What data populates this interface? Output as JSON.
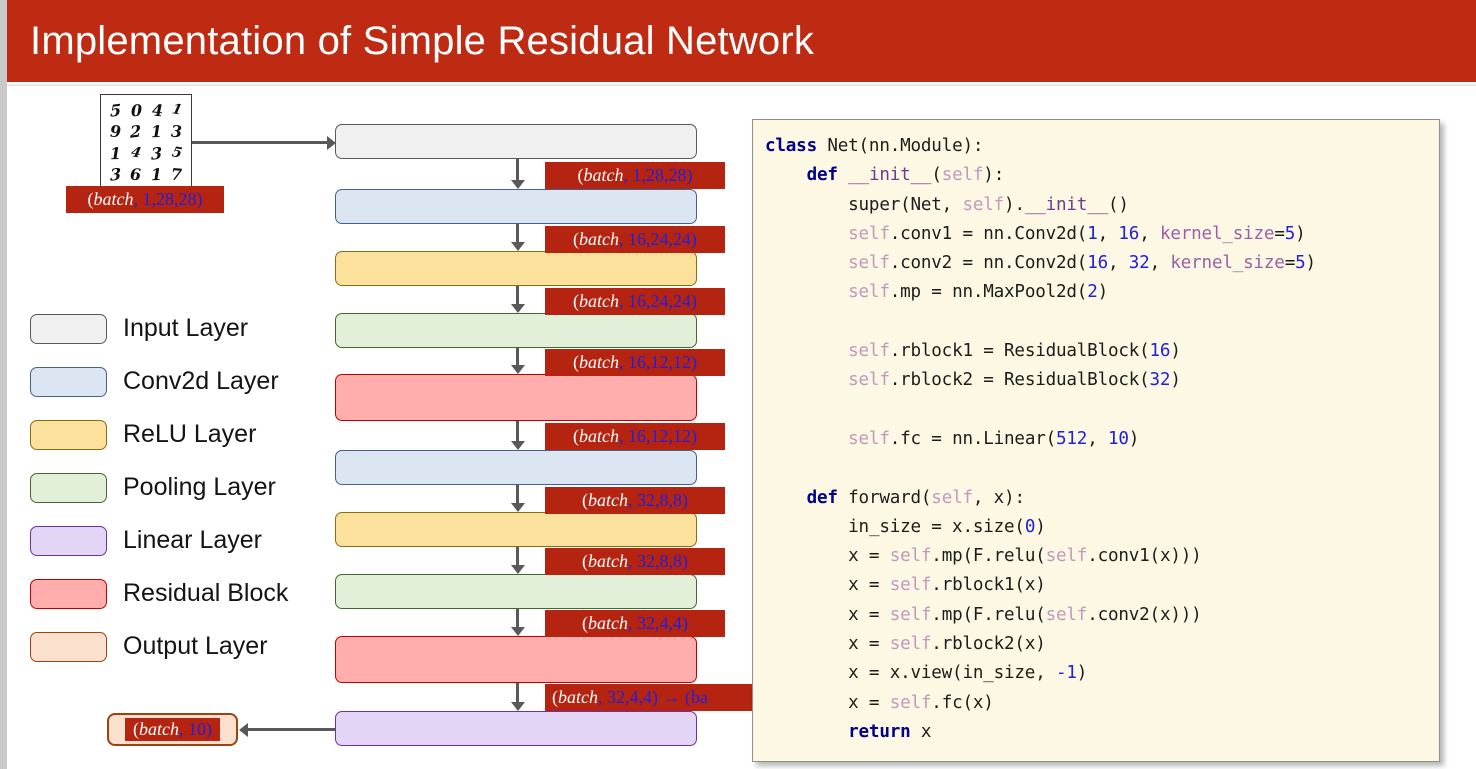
{
  "slide": {
    "title": "Implementation of Simple Residual Network",
    "title_bar_color": "#bf2a12",
    "background": "#ffffff"
  },
  "mnist_thumbnail": {
    "name": "mnist-digit-grid",
    "rows": [
      [
        "5",
        "0",
        "4",
        "1"
      ],
      [
        "9",
        "2",
        "1",
        "3"
      ],
      [
        "1",
        "4",
        "3",
        "5"
      ],
      [
        "3",
        "6",
        "1",
        "7"
      ]
    ]
  },
  "diagram": {
    "input_shape_tag": {
      "prefix": "(",
      "italic": "batch",
      "rest": ", 1,28,28)"
    },
    "layers": [
      {
        "type": "input",
        "name": "input-layer-box",
        "shape_out": {
          "italic": "batch",
          "rest": ", 1,28,28)"
        }
      },
      {
        "type": "conv",
        "name": "conv2d-layer-box-1",
        "shape_out": {
          "italic": "batch",
          "rest": ", 16,24,24)"
        }
      },
      {
        "type": "relu",
        "name": "relu-layer-box-1",
        "shape_out": {
          "italic": "batch",
          "rest": ", 16,24,24)"
        }
      },
      {
        "type": "pool",
        "name": "pooling-layer-box-1",
        "shape_out": {
          "italic": "batch",
          "rest": ", 16,12,12)"
        }
      },
      {
        "type": "res",
        "name": "residual-block-box-1",
        "shape_out": {
          "italic": "batch",
          "rest": ", 16,12,12)"
        }
      },
      {
        "type": "conv",
        "name": "conv2d-layer-box-2",
        "shape_out": {
          "italic": "batch",
          "rest": ", 32,8,8)"
        }
      },
      {
        "type": "relu",
        "name": "relu-layer-box-2",
        "shape_out": {
          "italic": "batch",
          "rest": ", 32,8,8)"
        }
      },
      {
        "type": "pool",
        "name": "pooling-layer-box-2",
        "shape_out": {
          "italic": "batch",
          "rest": ", 32,4,4)"
        }
      },
      {
        "type": "res",
        "name": "residual-block-box-2",
        "shape_out": {
          "italic": "batch",
          "rest": ", 32,4,4) → (ba"
        }
      },
      {
        "type": "linear",
        "name": "linear-layer-box",
        "shape_out": null
      }
    ],
    "output_pill": {
      "italic": "batch",
      "rest": ", 10)"
    }
  },
  "legend": {
    "items": [
      {
        "key": "input",
        "label": "Input Layer",
        "fill": "#f0f0f0",
        "stroke": "#595959"
      },
      {
        "key": "conv",
        "label": "Conv2d Layer",
        "fill": "#dce6f2",
        "stroke": "#40628c"
      },
      {
        "key": "relu",
        "label": "ReLU Layer",
        "fill": "#fce19c",
        "stroke": "#8a6d13"
      },
      {
        "key": "pool",
        "label": "Pooling Layer",
        "fill": "#e2efd9",
        "stroke": "#44692e"
      },
      {
        "key": "linear",
        "label": "Linear Layer",
        "fill": "#e3d5f5",
        "stroke": "#7030a0"
      },
      {
        "key": "res",
        "label": "Residual Block",
        "fill": "#ffadad",
        "stroke": "#c00000"
      },
      {
        "key": "output",
        "label": "Output Layer",
        "fill": "#fbe0ce",
        "stroke": "#9c4213"
      }
    ]
  },
  "code_panel": {
    "background": "#fdf8e3",
    "language": "python",
    "lines": [
      "class Net(nn.Module):",
      "    def __init__(self):",
      "        super(Net, self).__init__()",
      "        self.conv1 = nn.Conv2d(1, 16, kernel_size=5)",
      "        self.conv2 = nn.Conv2d(16, 32, kernel_size=5)",
      "        self.mp = nn.MaxPool2d(2)",
      "",
      "        self.rblock1 = ResidualBlock(16)",
      "        self.rblock2 = ResidualBlock(32)",
      "",
      "        self.fc = nn.Linear(512, 10)",
      "",
      "    def forward(self, x):",
      "        in_size = x.size(0)",
      "        x = self.mp(F.relu(self.conv1(x)))",
      "        x = self.rblock1(x)",
      "        x = self.mp(F.relu(self.conv2(x)))",
      "        x = self.rblock2(x)",
      "        x = x.view(in_size, -1)",
      "        x = self.fc(x)",
      "        return x"
    ]
  }
}
